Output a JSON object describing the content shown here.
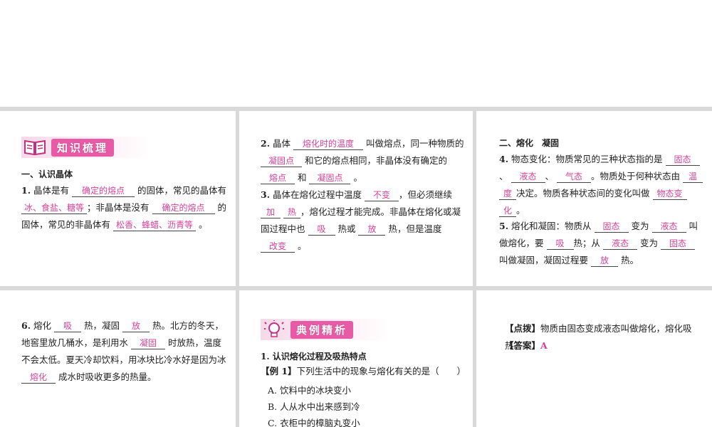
{
  "s1": {
    "banner": "知识梳理",
    "section": "一、认识晶体",
    "q1": {
      "num": "1.",
      "t1": "晶体是有",
      "a1": "确定的熔点",
      "t2": "的固体，常见的晶体有",
      "a2": "冰、食盐、糖等",
      "t3": "；非晶体是没有",
      "a3": "确定的熔点",
      "t4": "的固体，常见的非晶体有",
      "a4": "松香、蜂蜡、沥青等",
      "t5": "。"
    }
  },
  "s2": {
    "q2": {
      "num": "2.",
      "t1": "晶体",
      "a1": "熔化时的温度",
      "t2": "叫做熔点，同一种物质的",
      "a2": "凝固点",
      "t3": "和它的熔点相同，非晶体没有确定的",
      "a3": "熔点",
      "t4": "和",
      "a4": "凝固点",
      "t5": "。"
    },
    "q3": {
      "num": "3.",
      "t1": "晶体在熔化过程中温度",
      "a1": "不变",
      "t2": "，但必须继续",
      "a2a": "加",
      "a2b": "热",
      "t3": "，熔化过程才能完成。非晶体在熔化或凝固过程中也",
      "a3": "吸",
      "t4": "热或",
      "a4": "放",
      "t5": "热，但是温度",
      "a5": "改变",
      "t6": "。"
    }
  },
  "s3": {
    "section": "二、熔化　凝固",
    "q4": {
      "num": "4.",
      "t1": "物态变化：物质常见的三种状态指的是",
      "a1": "固态",
      "t2": "、",
      "a2": "液态",
      "t3": "、",
      "a3": "气态",
      "t4": "。物质处于何种状态由",
      "a4a": "温",
      "a4b": "度",
      "t5": "决定。物质各种状态间的变化叫做",
      "a5a": "物态变",
      "a5b": "化",
      "t6": "。"
    },
    "q5": {
      "num": "5.",
      "t1": "熔化和凝固：物质从",
      "a1": "固态",
      "t2": "变为",
      "a2": "液态",
      "t3": "叫做熔化，要",
      "a3": "吸",
      "t4": "热；从",
      "a4": "液态",
      "t5": "变为",
      "a5": "固态",
      "t6": "叫做凝固，凝固过程要",
      "a6": "放",
      "t7": "热。"
    }
  },
  "s4": {
    "q6": {
      "num": "6.",
      "t1": "熔化",
      "a1": "吸",
      "t2": "热，凝固",
      "a2": "放",
      "t3": "热。北方的冬天，地窖里放几桶水，是利用水",
      "a3": "凝固",
      "t4": "时放热，温度不会太低。夏天冷却饮料，用冰块比冷水好是因为冰",
      "a4": "熔化",
      "t5": "成水时吸收更多的热量。"
    }
  },
  "s5": {
    "banner": "典例精析",
    "section": "1. 认识熔化过程及吸热特点",
    "example_label": "【例 1】",
    "example_text": "下列生活中的现象与熔化有关的是（　　）",
    "options": [
      "A. 饮料中的冰块变小",
      "B. 人从水中出来感到冷",
      "C. 衣柜中的樟脑丸变小"
    ]
  },
  "s6": {
    "hint_label": "【点拨】",
    "hint_text": "物质由固态变成液态叫做熔化，熔化吸热。",
    "answer_label": "【答案】",
    "answer_value": "A"
  },
  "colors": {
    "accent": "#d6409a",
    "banner": "#e85aa6",
    "divider": "#d9d9d9"
  }
}
